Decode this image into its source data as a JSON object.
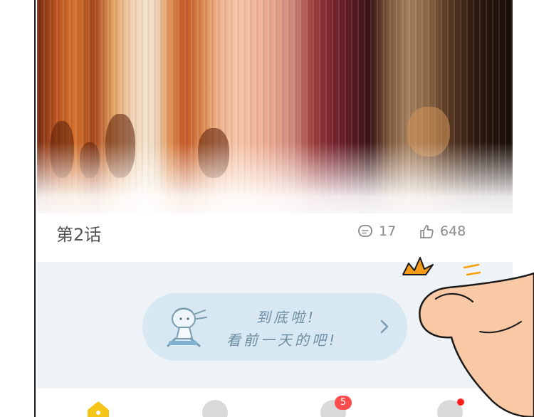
{
  "episode": {
    "title": "第2话",
    "comment_count": "17",
    "like_count": "648"
  },
  "end_banner": {
    "line1": "到底啦!",
    "line2": "看前一天的吧!"
  },
  "bottom_nav": {
    "items": [
      {
        "icon": "home-icon",
        "active": true
      },
      {
        "icon": "discover-icon",
        "active": false
      },
      {
        "icon": "message-icon",
        "badge": "5"
      },
      {
        "icon": "profile-icon",
        "dot": true
      }
    ]
  },
  "colors": {
    "accent": "#f5c518",
    "badge": "#ff4d4f",
    "banner_bg": "#d7e8f2",
    "banner_text": "#6e8ea3"
  }
}
